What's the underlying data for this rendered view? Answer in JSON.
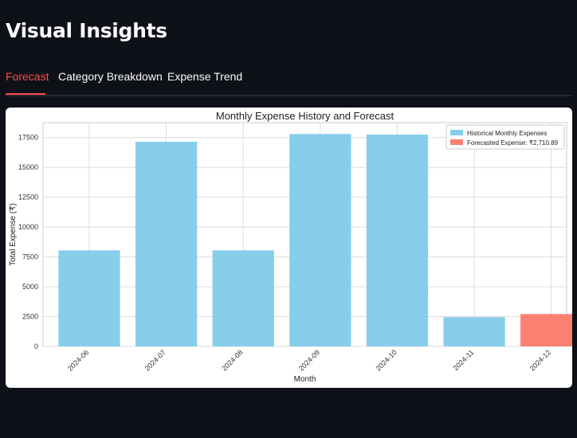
{
  "page": {
    "title": "Visual Insights"
  },
  "tabs": [
    {
      "label": "Forecast",
      "active": true
    },
    {
      "label": "Category Breakdown",
      "active": false
    },
    {
      "label": "Expense Trend",
      "active": false
    }
  ],
  "colors": {
    "accent": "#ff4b4b",
    "historical": "#87ceeb",
    "forecast": "#fa8072",
    "background": "#0e1117"
  },
  "chart_data": {
    "type": "bar",
    "title": "Monthly Expense History and Forecast",
    "xlabel": "Month",
    "ylabel": "Total Expense (₹)",
    "categories": [
      "2024-06",
      "2024-07",
      "2024-08",
      "2024-09",
      "2024-10",
      "2024-11",
      "2024-12"
    ],
    "series": [
      {
        "name": "Historical Monthly Expenses",
        "color": "#87ceeb",
        "values": [
          8050,
          17150,
          8050,
          17800,
          17750,
          2450,
          null
        ]
      },
      {
        "name": "Forecasted Expense: ₹2,710.89",
        "color": "#fa8072",
        "values": [
          null,
          null,
          null,
          null,
          null,
          null,
          2710.89
        ]
      }
    ],
    "yticks": [
      "0",
      "2500",
      "5000",
      "7500",
      "10000",
      "12500",
      "15000",
      "17500"
    ],
    "ylim": [
      0,
      18750
    ],
    "grid": true,
    "legend": "top-right"
  }
}
